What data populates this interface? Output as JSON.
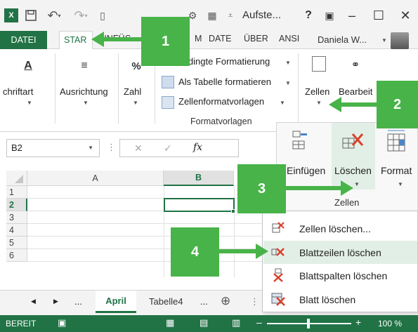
{
  "titlebar": {
    "excel_logo": "X",
    "title": "Aufste...",
    "help": "?",
    "minimize": "–",
    "maximize": "☐",
    "close": "✕"
  },
  "tabs": {
    "file": "DATEI",
    "active": "STAR",
    "others": [
      "EINFÜ",
      "S",
      "M",
      "DATE",
      "ÜBER",
      "ANSI"
    ],
    "user": "Daniela W..."
  },
  "ribbon": {
    "font_label": "chriftart",
    "alignment_label": "Ausrichtung",
    "number_label": "Zahl",
    "percent": "%",
    "cond_format": "Bedingte Formatierung",
    "table_format": "Als Tabelle formatieren",
    "cell_styles": "Zellenformatvorlagen",
    "styles_group": "Formatvorlagen",
    "cells_label": "Zellen",
    "edit_label": "Bearbeit"
  },
  "formula_bar": {
    "name_box": "B2",
    "fx": "fx",
    "cancel": "✕",
    "enter": "✓"
  },
  "grid": {
    "columns": [
      "A",
      "B"
    ],
    "rows": [
      "1",
      "2",
      "3",
      "4",
      "5",
      "6"
    ]
  },
  "cells_panel": {
    "insert": "Einfügen",
    "delete": "Löschen",
    "format": "Format",
    "group_label": "Zellen"
  },
  "delete_menu": {
    "items": [
      "Zellen löschen...",
      "Blattzeilen löschen",
      "Blattspalten löschen",
      "Blatt löschen"
    ]
  },
  "sheets": {
    "ellipsis": "...",
    "active": "April",
    "other": "Tabelle4",
    "more": "...",
    "add": "⊕"
  },
  "statusbar": {
    "status": "BEREIT",
    "zoom": "100 %"
  },
  "annotations": [
    "1",
    "2",
    "3",
    "4"
  ],
  "colors": {
    "excel_green": "#217346",
    "annotation_green": "#48b348",
    "highlight": "#e2efe6"
  }
}
